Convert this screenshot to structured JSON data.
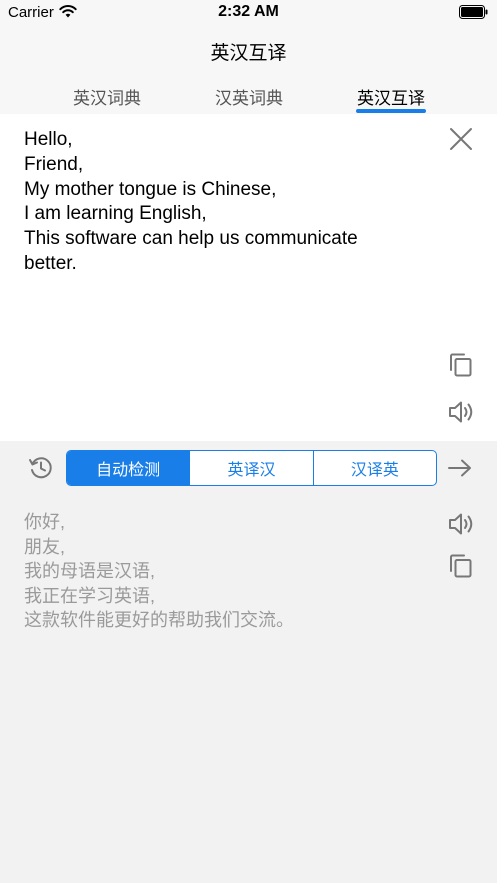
{
  "status_bar": {
    "carrier": "Carrier",
    "time": "2:32 AM"
  },
  "nav": {
    "title": "英汉互译"
  },
  "tabs": [
    {
      "label": "英汉词典",
      "active": false
    },
    {
      "label": "汉英词典",
      "active": false
    },
    {
      "label": "英汉互译",
      "active": true
    }
  ],
  "input": {
    "lines": [
      "Hello,",
      "Friend,",
      "My mother tongue is Chinese,",
      "I am learning English,",
      "This software can help us communicate",
      "better."
    ]
  },
  "toolbar": {
    "segments": [
      {
        "label": "自动检测",
        "selected": true
      },
      {
        "label": "英译汉",
        "selected": false
      },
      {
        "label": "汉译英",
        "selected": false
      }
    ]
  },
  "output": {
    "lines": [
      "你好,",
      "朋友,",
      "我的母语是汉语,",
      "我正在学习英语,",
      "这款软件能更好的帮助我们交流。"
    ]
  },
  "colors": {
    "accent": "#1a7ee8",
    "output_text": "#9a9a9a",
    "icon": "#777777"
  },
  "icons": [
    "wifi-icon",
    "battery-icon",
    "close-icon",
    "copy-icon",
    "speaker-icon",
    "history-icon",
    "arrow-right-icon"
  ]
}
